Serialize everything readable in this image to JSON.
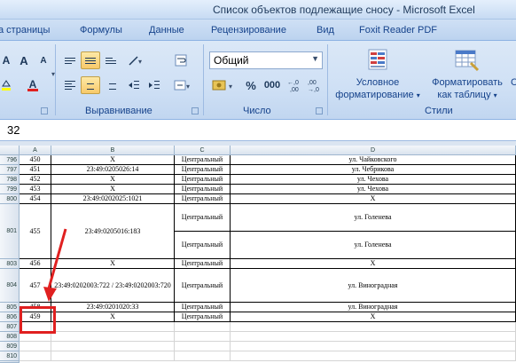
{
  "window": {
    "title": "Список объектов подлежащие сносу - Microsoft Excel"
  },
  "tabs": [
    "а страницы",
    "Формулы",
    "Данные",
    "Рецензирование",
    "Вид",
    "Foxit Reader PDF"
  ],
  "ribbon": {
    "groups": {
      "alignment": "Выравнивание",
      "number": "Число",
      "styles": "Стили"
    },
    "number_format": "Общий",
    "percent_symbol": "%",
    "thousands_symbol": "000",
    "decimal_inc": "←,0\n,00",
    "decimal_dec": ",00\n→,0",
    "conditional_formatting": [
      "Условное",
      "форматирование"
    ],
    "format_as_table": [
      "Форматировать",
      "как таблицу"
    ],
    "cell_styles_partial": "С",
    "font_color_letter": "A",
    "font_size_up": "A",
    "font_size_down": "A"
  },
  "formula_bar": {
    "value": "32"
  },
  "columns": [
    "A",
    "B",
    "C",
    "D"
  ],
  "rows": [
    {
      "num": "796",
      "a": "450",
      "b": "Х",
      "c": "Центральный",
      "d": "ул. Чайковского"
    },
    {
      "num": "797",
      "a": "451",
      "b": "23:49:0205026:14",
      "c": "Центральный",
      "d": "ул. Чебрикова"
    },
    {
      "num": "798",
      "a": "452",
      "b": "Х",
      "c": "Центральный",
      "d": "ул. Чехова"
    },
    {
      "num": "799",
      "a": "453",
      "b": "Х",
      "c": "Центральный",
      "d": "ул. Чехова"
    },
    {
      "num": "800",
      "a": "454",
      "b": "23:49:0202025:1021",
      "c": "Центральный",
      "d": "Х"
    },
    {
      "num": "801",
      "a": "455",
      "b": "23:49:0205016:183",
      "c": "Центральный",
      "d": "ул. Голенева",
      "c2": "Центральный",
      "d2": "ул. Голенева"
    },
    {
      "num": "803",
      "a": "456",
      "b": "Х",
      "c": "Центральный",
      "d": "Х"
    },
    {
      "num": "804",
      "a": "457",
      "b": "23:49:0202003:722 / 23:49:0202003:720",
      "c": "Центральный",
      "d": "ул. Виноградная"
    },
    {
      "num": "805",
      "a": "458",
      "b": "23:49:0201020:33",
      "c": "Центральный",
      "d": "ул. Виноградная"
    },
    {
      "num": "806",
      "a": "459",
      "b": "Х",
      "c": "Центральный",
      "d": "Х"
    },
    {
      "num": "807"
    },
    {
      "num": "808"
    },
    {
      "num": "809"
    },
    {
      "num": "810"
    }
  ],
  "colors": {
    "highlight": "#e02020",
    "ribbon": "#cfe0f5"
  }
}
